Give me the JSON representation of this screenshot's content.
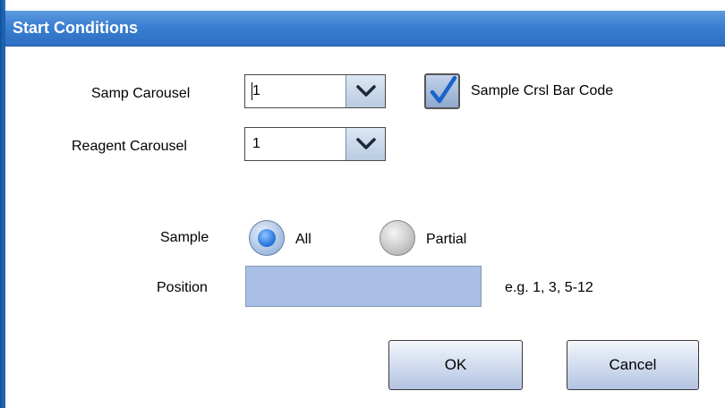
{
  "dialog": {
    "title": "Start Conditions"
  },
  "samp_carousel": {
    "label": "Samp Carousel",
    "value": "1"
  },
  "reagent_carousel": {
    "label": "Reagent Carousel",
    "value": "1"
  },
  "barcode_checkbox": {
    "label": "Sample Crsl Bar Code",
    "checked": true
  },
  "sample": {
    "label": "Sample",
    "options": [
      {
        "label": "All",
        "selected": true
      },
      {
        "label": "Partial",
        "selected": false
      }
    ]
  },
  "position": {
    "label": "Position",
    "value": "",
    "hint": "e.g. 1, 3, 5-12"
  },
  "buttons": {
    "ok": "OK",
    "cancel": "Cancel"
  },
  "icons": {
    "dropdown": "chevron-down-icon",
    "check": "checkmark-icon"
  },
  "colors": {
    "titlebar": "#3a7fd1",
    "accent": "#2c7be0",
    "field": "#a9bfe6"
  }
}
